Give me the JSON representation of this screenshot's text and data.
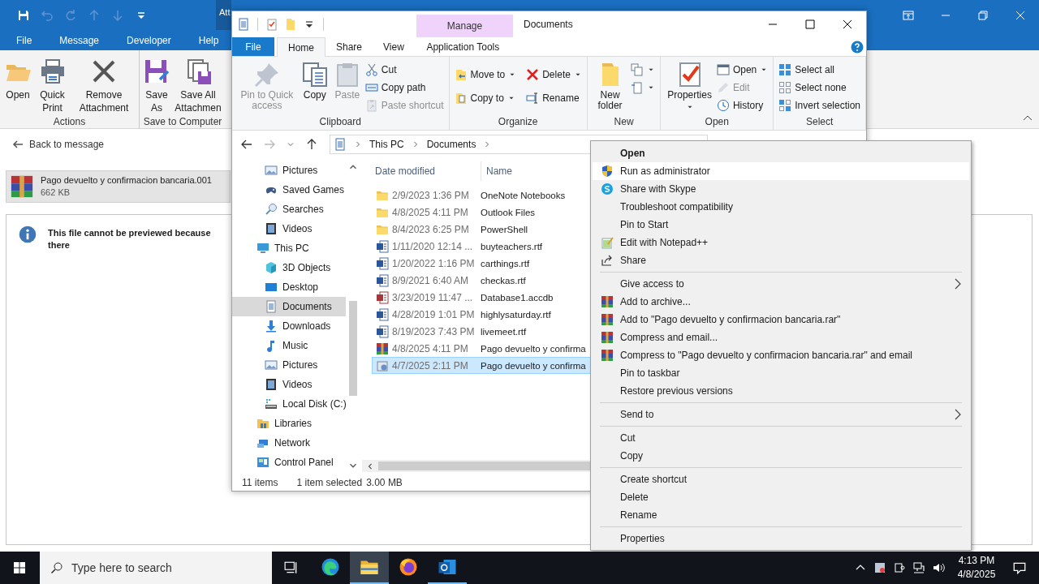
{
  "outlook": {
    "context_tab": "Att",
    "tabs": [
      {
        "label": "File",
        "selected": false
      },
      {
        "label": "Message",
        "selected": false
      },
      {
        "label": "Developer",
        "selected": false
      },
      {
        "label": "Help",
        "selected": false
      }
    ],
    "groups": [
      {
        "label": "Actions",
        "buttons": [
          {
            "label": "Open",
            "kind": "open"
          },
          {
            "label": "Quick Print",
            "kind": "print"
          },
          {
            "label": "Remove Attachment",
            "kind": "remove"
          }
        ]
      },
      {
        "label": "Save to Computer",
        "buttons": [
          {
            "label": "Save As",
            "kind": "saveas"
          },
          {
            "label": "Save All Attachmen",
            "kind": "saveall"
          }
        ]
      }
    ],
    "back_link": "Back to message",
    "attachment": {
      "name": "Pago devuelto y confirmacion bancaria.001",
      "size": "662 KB"
    },
    "preview_message": "This file cannot be previewed because there"
  },
  "explorer": {
    "context_tab": "Manage",
    "title": "Documents",
    "tabs": [
      {
        "label": "File",
        "kind": "file",
        "selected": false
      },
      {
        "label": "Home",
        "kind": "tab",
        "selected": true
      },
      {
        "label": "Share",
        "kind": "tab",
        "selected": false
      },
      {
        "label": "View",
        "kind": "tab",
        "selected": false
      },
      {
        "label": "Application Tools",
        "kind": "context",
        "selected": false
      }
    ],
    "ribbon": [
      {
        "label": "Clipboard",
        "large": [
          {
            "label": "Pin to Quick access",
            "kind": "pin",
            "disabled": true
          },
          {
            "label": "Copy",
            "kind": "copy",
            "disabled": false
          },
          {
            "label": "Paste",
            "kind": "paste",
            "disabled": true
          }
        ],
        "small": [
          {
            "label": "Cut",
            "kind": "cut",
            "disabled": false
          },
          {
            "label": "Copy path",
            "kind": "path",
            "disabled": false
          },
          {
            "label": "Paste shortcut",
            "kind": "shortcut",
            "disabled": true
          }
        ]
      },
      {
        "label": "Organize",
        "small": [
          {
            "label": "Move to",
            "kind": "move",
            "disabled": false,
            "dropdown": true
          },
          {
            "label": "Copy to",
            "kind": "copyto",
            "disabled": false,
            "dropdown": true
          },
          {
            "label": "Delete",
            "kind": "delete",
            "disabled": false,
            "dropdown": true
          },
          {
            "label": "Rename",
            "kind": "rename",
            "disabled": false
          }
        ]
      },
      {
        "label": "New",
        "large": [
          {
            "label": "New folder",
            "kind": "newfolder",
            "disabled": false
          }
        ],
        "small": [
          {
            "kind": "newitem",
            "disabled": false,
            "dropdown": true
          },
          {
            "kind": "easy",
            "disabled": false,
            "dropdown": true
          }
        ]
      },
      {
        "label": "Open",
        "large": [
          {
            "label": "Properties",
            "kind": "properties",
            "disabled": false,
            "dropdown": true
          }
        ],
        "small": [
          {
            "label": "Open",
            "kind": "openwith",
            "disabled": false,
            "dropdown": true
          },
          {
            "label": "Edit",
            "kind": "edit",
            "disabled": true
          },
          {
            "label": "History",
            "kind": "history",
            "disabled": false
          }
        ]
      },
      {
        "label": "Select",
        "small": [
          {
            "label": "Select all",
            "kind": "selectall",
            "disabled": false
          },
          {
            "label": "Select none",
            "kind": "selectnone",
            "disabled": false
          },
          {
            "label": "Invert selection",
            "kind": "invert",
            "disabled": false
          }
        ]
      }
    ],
    "address": {
      "crumbs": [
        "This PC",
        "Documents"
      ]
    },
    "nav": [
      {
        "children": [
          {
            "label": "Pictures",
            "kind": "pictures",
            "selected": false
          },
          {
            "label": "Saved Games",
            "kind": "games",
            "selected": false
          },
          {
            "label": "Searches",
            "kind": "search",
            "selected": false
          },
          {
            "label": "Videos",
            "kind": "videos",
            "selected": false
          }
        ]
      },
      {
        "label": "This PC",
        "kind": "pc",
        "selected": false,
        "children": [
          {
            "label": "3D Objects",
            "kind": "objects",
            "selected": false
          },
          {
            "label": "Desktop",
            "kind": "desktop",
            "selected": false
          },
          {
            "label": "Documents",
            "kind": "documents",
            "selected": true
          },
          {
            "label": "Downloads",
            "kind": "downloads",
            "selected": false
          },
          {
            "label": "Music",
            "kind": "music",
            "selected": false
          },
          {
            "label": "Pictures",
            "kind": "pictures",
            "selected": false
          },
          {
            "label": "Videos",
            "kind": "videos",
            "selected": false
          },
          {
            "label": "Local Disk (C:)",
            "kind": "disk",
            "selected": false
          }
        ]
      },
      {
        "label": "Libraries",
        "kind": "libraries",
        "selected": false
      },
      {
        "label": "Network",
        "kind": "network",
        "selected": false
      },
      {
        "label": "Control Panel",
        "kind": "panel",
        "selected": false
      }
    ],
    "columns": [
      "Date modified",
      "Name"
    ],
    "files": [
      {
        "date": "2/9/2023 1:36 PM",
        "name": "OneNote Notebooks",
        "kind": "folder",
        "selected": false
      },
      {
        "date": "4/8/2025 4:11 PM",
        "name": "Outlook Files",
        "kind": "folder",
        "selected": false
      },
      {
        "date": "8/4/2023 6:25 PM",
        "name": "PowerShell",
        "kind": "folder",
        "selected": false
      },
      {
        "date": "1/11/2020 12:14 ...",
        "name": "buyteachers.rtf",
        "kind": "word",
        "selected": false
      },
      {
        "date": "1/20/2022 1:16 PM",
        "name": "carthings.rtf",
        "kind": "word",
        "selected": false
      },
      {
        "date": "8/9/2021 6:40 AM",
        "name": "checkas.rtf",
        "kind": "word",
        "selected": false
      },
      {
        "date": "3/23/2019 11:47 ...",
        "name": "Database1.accdb",
        "kind": "access",
        "selected": false
      },
      {
        "date": "4/28/2019 1:01 PM",
        "name": "highlysaturday.rtf",
        "kind": "word",
        "selected": false
      },
      {
        "date": "8/19/2023 7:43 PM",
        "name": "livemeet.rtf",
        "kind": "word",
        "selected": false
      },
      {
        "date": "4/8/2025 4:11 PM",
        "name": "Pago devuelto y confirma",
        "kind": "rar",
        "selected": false
      },
      {
        "date": "4/7/2025 2:11 PM",
        "name": "Pago devuelto y confirma",
        "kind": "app",
        "selected": true
      }
    ],
    "status": {
      "count": "11 items",
      "selection": "1 item selected",
      "size": "3.00 MB"
    }
  },
  "context_menu": [
    [
      {
        "label": "Open",
        "kind": "default",
        "selected": false
      },
      {
        "label": "Run as administrator",
        "kind": "shield",
        "selected": true
      },
      {
        "label": "Share with Skype",
        "kind": "skype",
        "selected": false
      },
      {
        "label": "Troubleshoot compatibility",
        "kind": "plain",
        "selected": false
      },
      {
        "label": "Pin to Start",
        "kind": "plain",
        "selected": false
      },
      {
        "label": "Edit with Notepad++",
        "kind": "notepad",
        "selected": false
      },
      {
        "label": "Share",
        "kind": "share",
        "selected": false
      }
    ],
    [
      {
        "label": "Give access to",
        "kind": "submenu",
        "selected": false
      },
      {
        "label": "Add to archive...",
        "kind": "archive",
        "selected": false
      },
      {
        "label": "Add to \"Pago devuelto y confirmacion bancaria.rar\"",
        "kind": "archive",
        "selected": false
      },
      {
        "label": "Compress and email...",
        "kind": "archive",
        "selected": false
      },
      {
        "label": "Compress to \"Pago devuelto y confirmacion bancaria.rar\" and email",
        "kind": "archive",
        "selected": false
      },
      {
        "label": "Pin to taskbar",
        "kind": "plain",
        "selected": false
      },
      {
        "label": "Restore previous versions",
        "kind": "plain",
        "selected": false
      }
    ],
    [
      {
        "label": "Send to",
        "kind": "submenu",
        "selected": false
      }
    ],
    [
      {
        "label": "Cut",
        "kind": "plain",
        "selected": false
      },
      {
        "label": "Copy",
        "kind": "plain",
        "selected": false
      }
    ],
    [
      {
        "label": "Create shortcut",
        "kind": "plain",
        "selected": false
      },
      {
        "label": "Delete",
        "kind": "plain",
        "selected": false
      },
      {
        "label": "Rename",
        "kind": "plain",
        "selected": false
      }
    ],
    [
      {
        "label": "Properties",
        "kind": "plain",
        "selected": false
      }
    ]
  ],
  "taskbar": {
    "search_placeholder": "Type here to search",
    "apps": [
      {
        "kind": "edge",
        "selected": false,
        "running": false
      },
      {
        "kind": "explorer",
        "selected": true,
        "running": true
      },
      {
        "kind": "firefox",
        "selected": false,
        "running": false
      },
      {
        "kind": "outlook",
        "selected": false,
        "running": true
      }
    ],
    "time": "4:13 PM",
    "date": "4/8/2025"
  }
}
